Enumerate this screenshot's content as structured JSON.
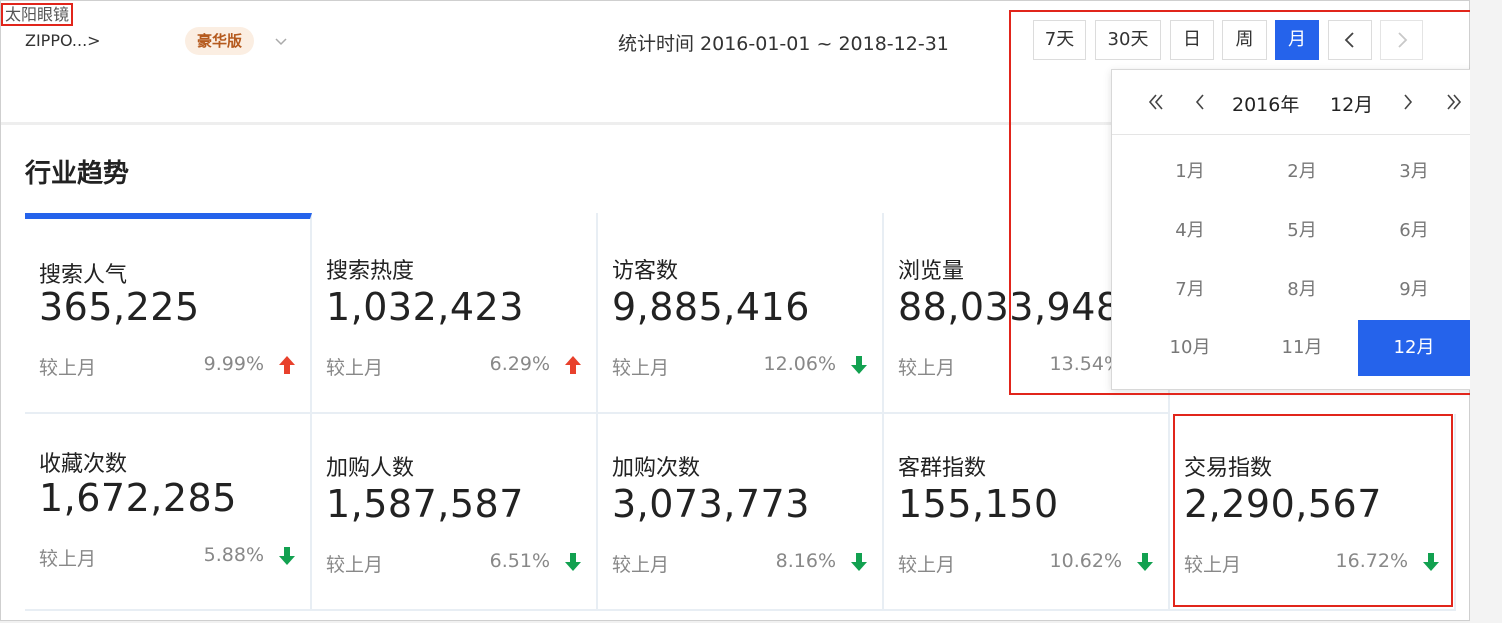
{
  "header": {
    "breadcrumb_root": "ZIPPO...>",
    "breadcrumb_current": "太阳眼镜",
    "edition_badge": "豪华版",
    "stat_time": "统计时间 2016-01-01 ~ 2018-12-31"
  },
  "range_buttons": [
    "7天",
    "30天",
    "日",
    "周",
    "月"
  ],
  "active_range": "月",
  "picker": {
    "year": "2016年",
    "month": "12月",
    "months": [
      "1月",
      "2月",
      "3月",
      "4月",
      "5月",
      "6月",
      "7月",
      "8月",
      "9月",
      "10月",
      "11月",
      "12月"
    ],
    "selected": "12月"
  },
  "section_title": "行业趋势",
  "compare_label": "较上月",
  "cards": [
    {
      "label": "搜索人气",
      "value": "365,225",
      "pct": "9.99%",
      "trend": "up"
    },
    {
      "label": "搜索热度",
      "value": "1,032,423",
      "pct": "6.29%",
      "trend": "up"
    },
    {
      "label": "访客数",
      "value": "9,885,416",
      "pct": "12.06%",
      "trend": "down"
    },
    {
      "label": "浏览量",
      "value": "88,033,948",
      "pct": "13.54%",
      "trend": "down"
    },
    {
      "label": "收藏次数",
      "value": "1,672,285",
      "pct": "5.88%",
      "trend": "down"
    },
    {
      "label": "加购人数",
      "value": "1,587,587",
      "pct": "6.51%",
      "trend": "down"
    },
    {
      "label": "加购次数",
      "value": "3,073,773",
      "pct": "8.16%",
      "trend": "down"
    },
    {
      "label": "客群指数",
      "value": "155,150",
      "pct": "10.62%",
      "trend": "down"
    },
    {
      "label": "交易指数",
      "value": "2,290,567",
      "pct": "16.72%",
      "trend": "down"
    }
  ],
  "colors": {
    "accent": "#2563eb",
    "up": "#e8412c",
    "down": "#12a150",
    "annotation": "#e1251b"
  }
}
